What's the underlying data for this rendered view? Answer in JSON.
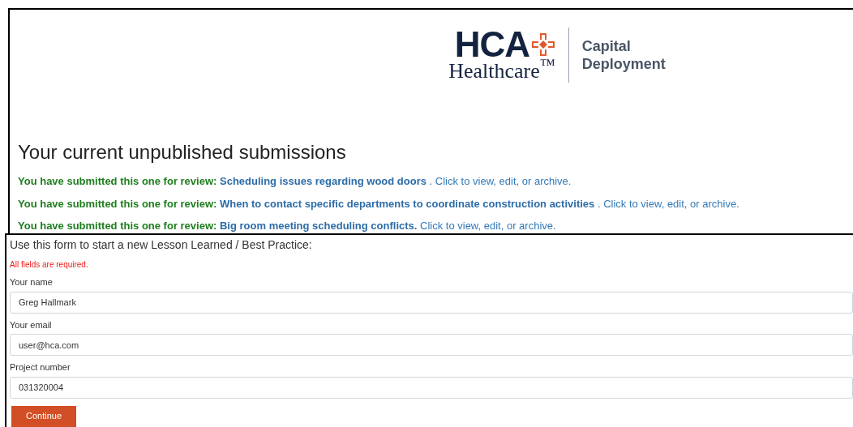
{
  "logo": {
    "brand": "HCA",
    "subtitle": "Healthcare$^{™}$",
    "division": [
      "Capital",
      "Deployment"
    ]
  },
  "submissions": {
    "heading": "Your current unpublished submissions",
    "items": [
      {
        "prefix": "You have submitted this one for review:",
        "link": "Scheduling issues regarding wood doors",
        "suffix": ". Click to view, edit, or archive."
      },
      {
        "prefix": "You have submitted this one for review:",
        "link": "When to contact specific departments to coordinate construction activities",
        "suffix": ". Click to view, edit, or archive."
      },
      {
        "prefix": "You have submitted this one for review:",
        "link": "Big room meeting scheduling conflicts.",
        "suffix": "Click to view, edit, or archive."
      }
    ]
  },
  "form": {
    "heading": "Use this form to start a new Lesson Learned / Best Practice:",
    "notice": "All fields are required.",
    "fields": [
      {
        "label": "Your name",
        "value": "Greg Hallmark"
      },
      {
        "label": "Your email",
        "value": "user@hca.com"
      },
      {
        "label": "Project number",
        "value": "031320004"
      }
    ],
    "button": "Continue"
  }
}
